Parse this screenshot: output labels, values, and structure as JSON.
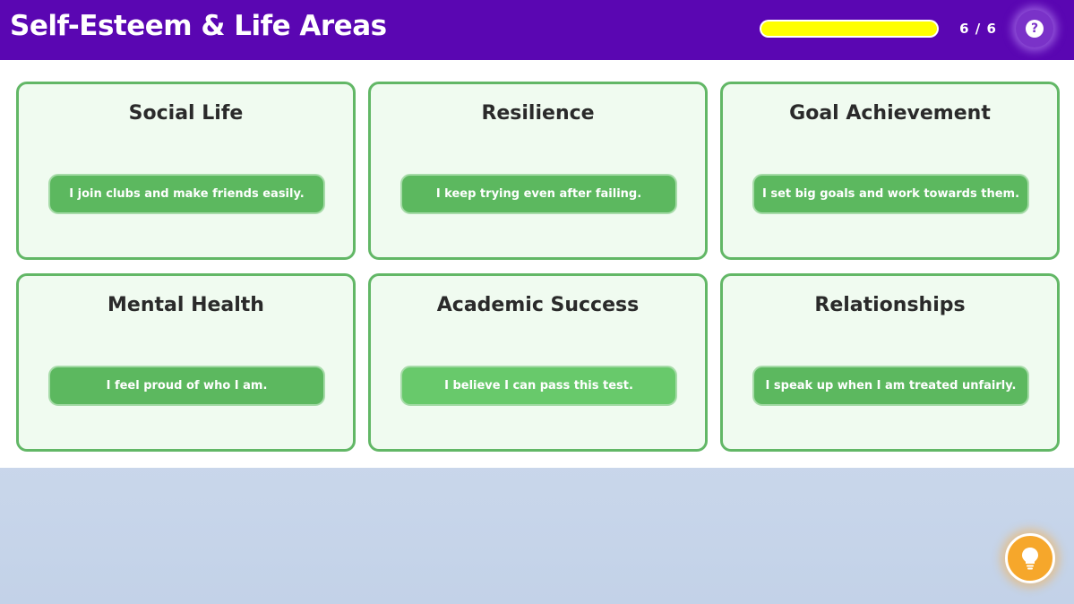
{
  "app": {
    "title": "Self-Esteem & Life Areas"
  },
  "progress": {
    "text": "6 / 6",
    "fraction": 1.0,
    "bar_color": "#ffff00"
  },
  "help": {
    "icon": "question-circle-icon",
    "glyph": "?"
  },
  "hint": {
    "icon": "lightbulb-icon"
  },
  "theme": {
    "header_color": "#5a06b2",
    "card_border": "#62b766",
    "card_background": "#f0fbf0",
    "statement_color": "#5cb85f",
    "hint_color": "#f6a72b"
  },
  "cards": [
    {
      "area": "Social Life",
      "statement": "I join clubs and make friends easily."
    },
    {
      "area": "Resilience",
      "statement": "I keep trying even after failing."
    },
    {
      "area": "Goal Achievement",
      "statement": "I set big goals and work towards them."
    },
    {
      "area": "Mental Health",
      "statement": "I feel proud of who I am."
    },
    {
      "area": "Academic Success",
      "statement": "I believe I can pass this test."
    },
    {
      "area": "Relationships",
      "statement": "I speak up when I am treated unfairly."
    }
  ]
}
